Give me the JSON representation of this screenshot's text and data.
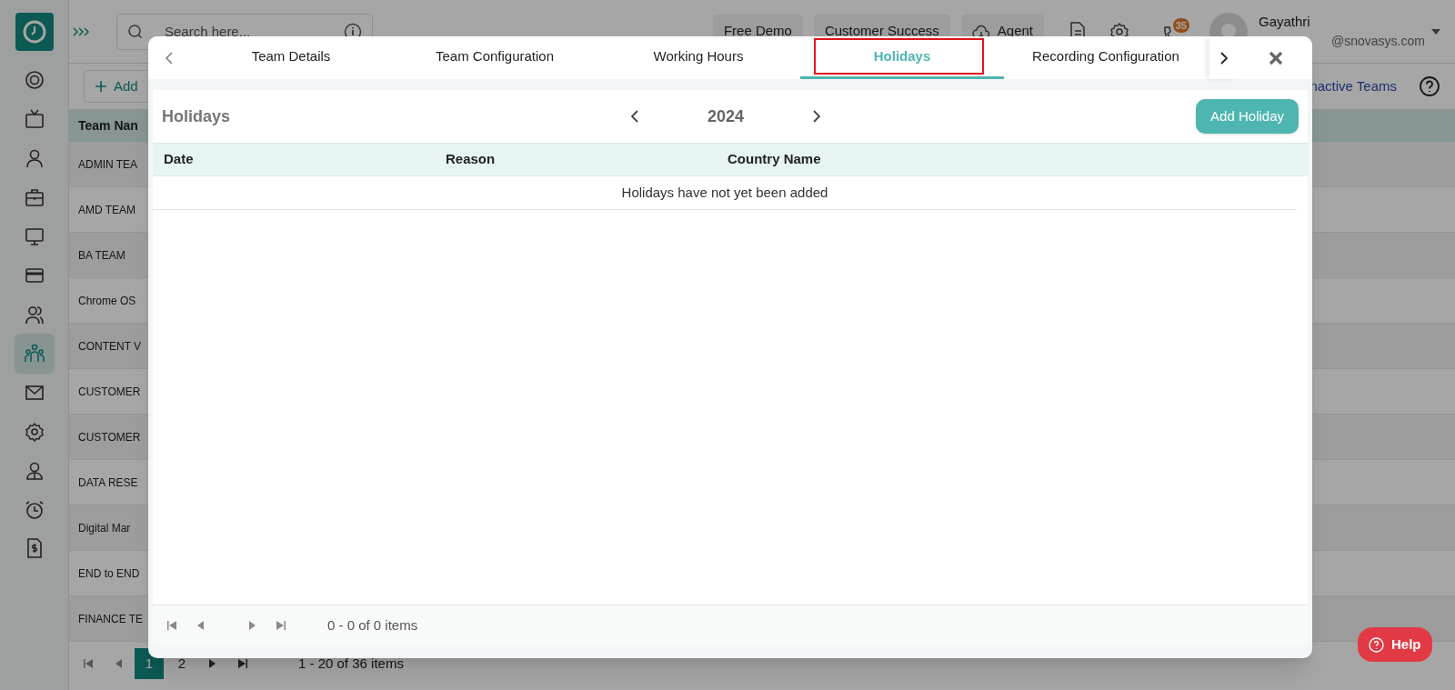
{
  "header": {
    "search": {
      "placeholder": "Search here..."
    },
    "buttons": [
      "Free Demo",
      "Customer Success",
      "Agent"
    ],
    "notification_badge": "35",
    "user": {
      "name": "Gayathri",
      "email": "@snovasys.com"
    }
  },
  "sidebar": {
    "items": [
      {
        "selected": false
      },
      {
        "selected": false
      },
      {
        "selected": false
      },
      {
        "selected": false
      },
      {
        "selected": false
      },
      {
        "selected": false
      },
      {
        "selected": false
      },
      {
        "selected": true
      },
      {
        "selected": false
      },
      {
        "selected": false
      },
      {
        "selected": false
      },
      {
        "selected": false
      }
    ]
  },
  "toolbar": {
    "add_button": "Add",
    "inactive_link": "nactive Teams"
  },
  "team_table": {
    "header": "Team Nan",
    "rows": [
      "ADMIN TEA",
      "AMD TEAM",
      "BA TEAM",
      "Chrome OS",
      "CONTENT V",
      "CUSTOMER",
      "CUSTOMER",
      "DATA RESE",
      "Digital Mar",
      "END to END",
      "FINANCE TE"
    ]
  },
  "pagination": {
    "pages": [
      {
        "label": "1",
        "selected": true
      },
      {
        "label": "2",
        "selected": false
      }
    ],
    "summary": "1 - 20 of 36 items"
  },
  "help_button": "Help",
  "modal": {
    "tabs": [
      {
        "label": "Team Details",
        "selected": false
      },
      {
        "label": "Team Configuration",
        "selected": false
      },
      {
        "label": "Working Hours",
        "selected": false
      },
      {
        "label": "Holidays",
        "selected": true,
        "highlighted": true
      },
      {
        "label": "Recording Configuration",
        "selected": false
      }
    ],
    "title": "Holidays",
    "year": "2024",
    "add_button": "Add Holiday",
    "columns": [
      "Date",
      "Reason",
      "Country Name"
    ],
    "empty_message": "Holidays have not yet been added",
    "pager_summary": "0 - 0 of 0 items"
  }
}
